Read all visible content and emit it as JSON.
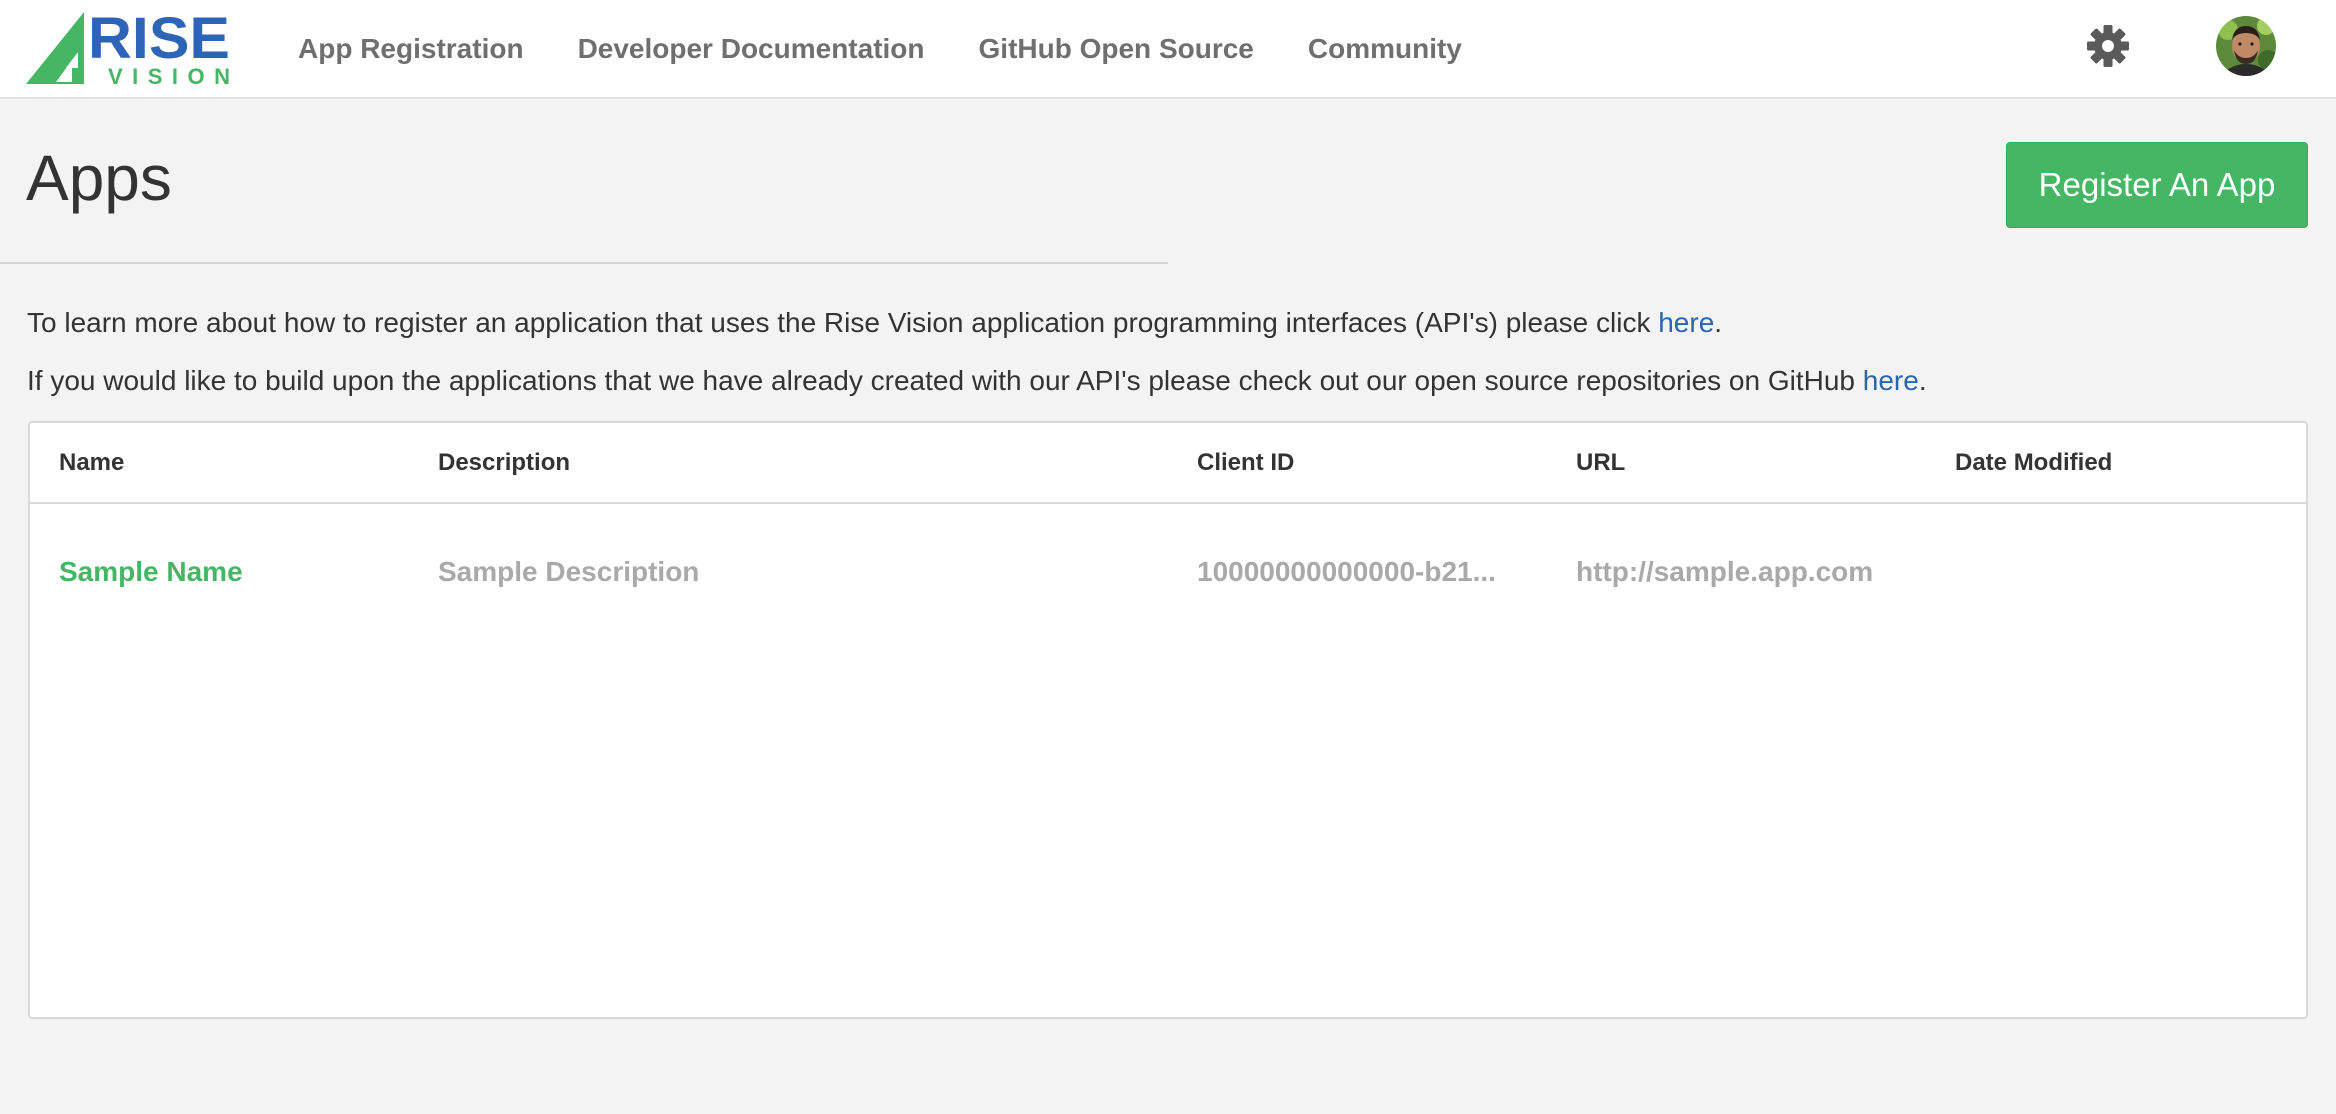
{
  "header": {
    "logo": {
      "top_text": "RISE",
      "bottom_text": "VISION",
      "brand_blue": "#2e64b8",
      "brand_green": "#45b764"
    },
    "nav": [
      {
        "label": "App Registration"
      },
      {
        "label": "Developer Documentation"
      },
      {
        "label": "GitHub Open Source"
      },
      {
        "label": "Community"
      }
    ],
    "settings_icon": "gear-icon",
    "avatar_icon": "user-avatar"
  },
  "page": {
    "title": "Apps",
    "register_button": "Register An App",
    "accent_color": "#45b764",
    "link_color": "#2a66b0"
  },
  "info": {
    "line1_text": "To learn more about how to register an application that uses the Rise Vision application programming interfaces (API's) please click ",
    "line1_link": "here",
    "line1_end": ".",
    "line2_text": "If you would like to build upon the applications that we have already created with our API's please check out our open source repositories on GitHub ",
    "line2_link": "here",
    "line2_end": "."
  },
  "table": {
    "columns": [
      "Name",
      "Description",
      "Client ID",
      "URL",
      "Date Modified"
    ],
    "rows": [
      {
        "name": "Sample Name",
        "description": "Sample Description",
        "client_id": "10000000000000-b21...",
        "url": "http://sample.app.com",
        "date_modified": ""
      }
    ]
  }
}
